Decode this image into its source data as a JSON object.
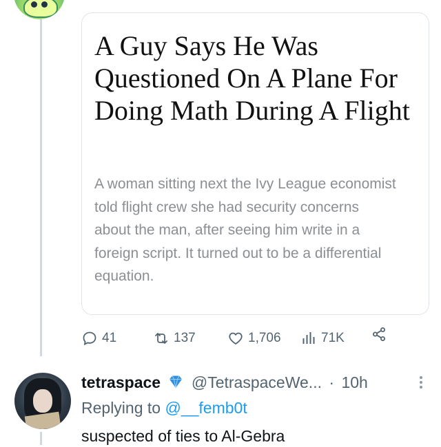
{
  "article": {
    "headline": "A Guy Says He Was Questioned On A Plane For Doing Math During A Flight",
    "summary": "A woman sitting next the Ivy League economist told flight crew she had security concerns about the man, after seeing him write in a foreign script. It turned out to be a differential equation."
  },
  "actions": {
    "replies": "41",
    "retweets": "137",
    "likes": "1,706",
    "views": "71K",
    "icons": [
      "reply-icon",
      "retweet-icon",
      "like-icon",
      "views-icon",
      "share-icon"
    ]
  },
  "reply": {
    "display_name": "tetraspace",
    "handle": "@TetraspaceWe...",
    "separator": "·",
    "time": "10h",
    "replying_label": "Replying to",
    "replying_to": "@__femb0t",
    "text": "suspected of ties to Al-Gebra"
  },
  "colors": {
    "text_primary": "#0f1419",
    "text_secondary": "#536471",
    "link": "#1d9bf0",
    "summary_gray": "#8b8f93",
    "verified": "#2f8fe0"
  }
}
